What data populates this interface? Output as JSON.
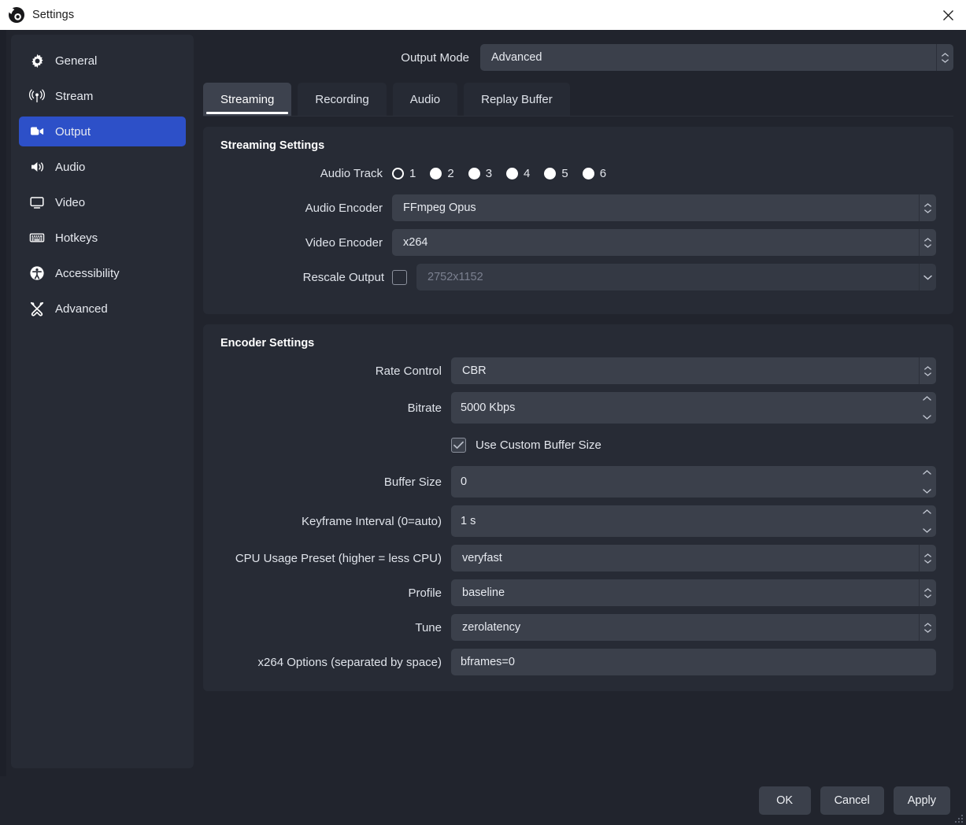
{
  "titlebar": {
    "title": "Settings",
    "app_icon": "obs-logo-icon",
    "close_icon": "close-icon"
  },
  "colors": {
    "accent": "#2d50c8",
    "window_bg": "#21242d",
    "panel_bg": "#272b35",
    "field_bg": "#3b404b",
    "field_disabled_bg": "#343944",
    "text": "#e3e6ec",
    "text_disabled": "#7b8090",
    "titlebar_bg": "#ffffff",
    "titlebar_text": "#1b1b1b"
  },
  "sidebar": {
    "items": [
      {
        "label": "General",
        "icon": "gear-icon",
        "active": false
      },
      {
        "label": "Stream",
        "icon": "broadcast-icon",
        "active": false
      },
      {
        "label": "Output",
        "icon": "output-video-icon",
        "active": true
      },
      {
        "label": "Audio",
        "icon": "speaker-icon",
        "active": false
      },
      {
        "label": "Video",
        "icon": "monitor-icon",
        "active": false
      },
      {
        "label": "Hotkeys",
        "icon": "keyboard-icon",
        "active": false
      },
      {
        "label": "Accessibility",
        "icon": "accessibility-icon",
        "active": false
      },
      {
        "label": "Advanced",
        "icon": "tools-icon",
        "active": false
      }
    ]
  },
  "output_mode": {
    "label": "Output Mode",
    "value": "Advanced"
  },
  "tabs": [
    {
      "label": "Streaming",
      "active": true
    },
    {
      "label": "Recording",
      "active": false
    },
    {
      "label": "Audio",
      "active": false
    },
    {
      "label": "Replay Buffer",
      "active": false
    }
  ],
  "streaming_settings": {
    "title": "Streaming Settings",
    "audio_track": {
      "label": "Audio Track",
      "options": [
        "1",
        "2",
        "3",
        "4",
        "5",
        "6"
      ],
      "selected": "1"
    },
    "audio_encoder": {
      "label": "Audio Encoder",
      "value": "FFmpeg Opus"
    },
    "video_encoder": {
      "label": "Video Encoder",
      "value": "x264"
    },
    "rescale_output": {
      "label": "Rescale Output",
      "checked": false,
      "value": "2752x1152",
      "enabled": false
    }
  },
  "encoder_settings": {
    "title": "Encoder Settings",
    "rate_control": {
      "label": "Rate Control",
      "value": "CBR"
    },
    "bitrate": {
      "label": "Bitrate",
      "value": "5000 Kbps"
    },
    "use_custom_buffer_size": {
      "label": "Use Custom Buffer Size",
      "checked": true
    },
    "buffer_size": {
      "label": "Buffer Size",
      "value": "0"
    },
    "keyframe_interval": {
      "label": "Keyframe Interval (0=auto)",
      "value": "1 s"
    },
    "cpu_usage_preset": {
      "label": "CPU Usage Preset (higher = less CPU)",
      "value": "veryfast"
    },
    "profile": {
      "label": "Profile",
      "value": "baseline"
    },
    "tune": {
      "label": "Tune",
      "value": "zerolatency"
    },
    "x264_options": {
      "label": "x264 Options (separated by space)",
      "value": "bframes=0"
    }
  },
  "footer": {
    "ok": "OK",
    "cancel": "Cancel",
    "apply": "Apply"
  }
}
